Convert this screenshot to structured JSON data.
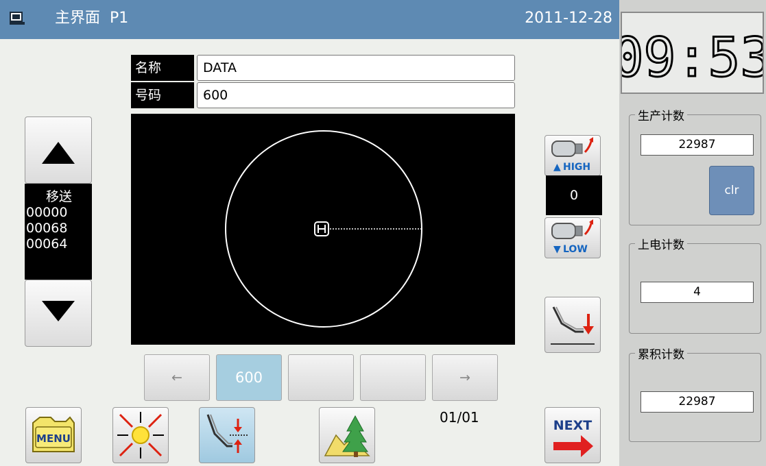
{
  "header": {
    "title": "主界面  P1",
    "date": "2011-12-28",
    "icon": "monitor-icon",
    "background": "#5e8ab3"
  },
  "clock": {
    "time": "09:53"
  },
  "counters": {
    "production": {
      "label": "生产计数",
      "value": "22987",
      "clear_label": "clr"
    },
    "power_on": {
      "label": "上电计数",
      "value": "4"
    },
    "cumulative": {
      "label": "累积计数",
      "value": "22987"
    }
  },
  "pattern": {
    "name_label": "名称",
    "name_value": "DATA",
    "number_label": "号码",
    "number_value": "600"
  },
  "move": {
    "label": "移送",
    "values": [
      "00000",
      "00068",
      "00064"
    ],
    "up_icon": "arrow-up-icon",
    "down_icon": "arrow-down-icon"
  },
  "speed": {
    "high_label": "HIGH",
    "low_label": "LOW",
    "value": "0"
  },
  "pages": {
    "prev": "←",
    "next": "→",
    "items": [
      "600",
      "",
      ""
    ],
    "counter": "01/01"
  },
  "toolbar": {
    "menu_label": "MENU",
    "next_label": "NEXT"
  }
}
